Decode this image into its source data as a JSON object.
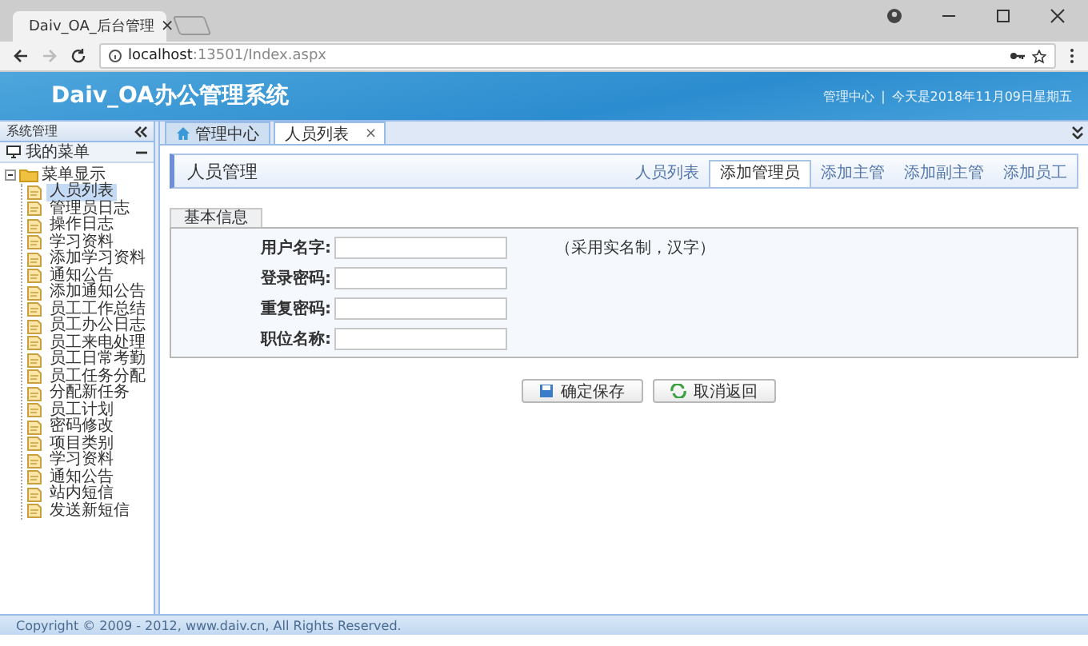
{
  "browser": {
    "tab_title": "Daiv_OA_后台管理",
    "tab_close": "×",
    "url_host": "localhost",
    "url_rest": ":13501/Index.aspx"
  },
  "header": {
    "title": "Daiv_OA办公管理系统",
    "link": "管理中心",
    "separator": "|",
    "date": "今天是2018年11月09日星期五"
  },
  "sidebar": {
    "title": "系统管理",
    "menu_title": "我的菜单",
    "tree": {
      "label": "菜单显示",
      "expanded": true,
      "children": [
        {
          "label": "人员列表",
          "selected": true
        },
        {
          "label": "管理员日志",
          "selected": false
        },
        {
          "label": "操作日志",
          "selected": false
        },
        {
          "label": "学习资料",
          "selected": false
        },
        {
          "label": "添加学习资料",
          "selected": false
        },
        {
          "label": "通知公告",
          "selected": false
        },
        {
          "label": "添加通知公告",
          "selected": false
        },
        {
          "label": "员工工作总结",
          "selected": false
        },
        {
          "label": "员工办公日志",
          "selected": false
        },
        {
          "label": "员工来电处理",
          "selected": false
        },
        {
          "label": "员工日常考勤",
          "selected": false
        },
        {
          "label": "员工任务分配",
          "selected": false
        },
        {
          "label": "分配新任务",
          "selected": false
        },
        {
          "label": "员工计划",
          "selected": false
        },
        {
          "label": "密码修改",
          "selected": false
        },
        {
          "label": "项目类别",
          "selected": false
        },
        {
          "label": "学习资料",
          "selected": false
        },
        {
          "label": "通知公告",
          "selected": false
        },
        {
          "label": "站内短信",
          "selected": false
        },
        {
          "label": "发送新短信",
          "selected": false
        }
      ]
    }
  },
  "tabs": [
    {
      "label": "管理中心",
      "kind": "home",
      "selected": false
    },
    {
      "label": "人员列表",
      "kind": "closable",
      "close": "×",
      "selected": true
    }
  ],
  "panel": {
    "title": "人员管理",
    "tabs": [
      {
        "label": "人员列表",
        "selected": false
      },
      {
        "label": "添加管理员",
        "selected": true
      },
      {
        "label": "添加主管",
        "selected": false
      },
      {
        "label": "添加副主管",
        "selected": false
      },
      {
        "label": "添加员工",
        "selected": false
      }
    ]
  },
  "form": {
    "section": "基本信息",
    "hint": "（采用实名制，汉字）",
    "fields": [
      {
        "label": "用户名字:"
      },
      {
        "label": "登录密码:"
      },
      {
        "label": "重复密码:"
      },
      {
        "label": "职位名称:"
      }
    ],
    "buttons": [
      {
        "label": "确定保存",
        "kind": "save"
      },
      {
        "label": "取消返回",
        "kind": "back"
      }
    ]
  },
  "footer": {
    "copyright": "Copyright © 2009 - 2012, www.daiv.cn, All Rights Reserved."
  }
}
